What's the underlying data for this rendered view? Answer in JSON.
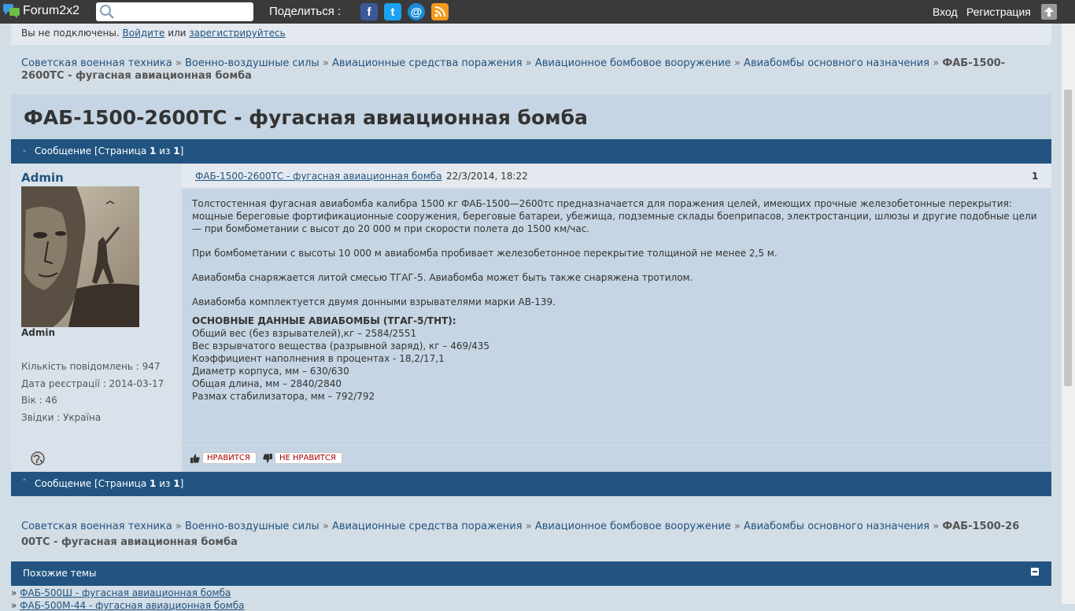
{
  "topbar": {
    "logo_text": "Forum2x2",
    "search_value": "",
    "share_label": "Поделиться :",
    "share_icons": [
      "facebook-icon",
      "twitter-icon",
      "email-icon",
      "rss-icon"
    ],
    "login": "Вход",
    "register": "Регистрация"
  },
  "notice": {
    "prefix": "Вы не подключены.",
    "login_link": "Войдите",
    "or": "или",
    "register_link": "зарегистрируйтесь"
  },
  "breadcrumb": {
    "items": [
      "Советская военная техника",
      "Военно-воздушные силы",
      "Авиационные средства поражения",
      "Авиационное бомбовое вооружение",
      "Авиабомбы основного назначения"
    ],
    "separator": "»",
    "current": "ФАБ-1500-2600ТС - фугасная авиационная бомба"
  },
  "page_title": "ФАБ-1500-2600ТС - фугасная авиационная бомба",
  "pager": {
    "label": "Сообщение [Страница",
    "page": "1",
    "of": "из",
    "total": "1",
    "close": "]"
  },
  "post": {
    "author": "Admin",
    "rank": "Admin",
    "profile": [
      {
        "label": "Кількість повідомлень",
        "value": "947"
      },
      {
        "label": "Дата реєстрації",
        "value": "2014-03-17"
      },
      {
        "label": "Вік",
        "value": "46"
      },
      {
        "label": "Звідки",
        "value": "Україна"
      }
    ],
    "profile_sep": " : ",
    "title_link": "ФАБ-1500-2600ТС - фугасная авиационная бомба",
    "date": "22/3/2014, 18:22",
    "number": "1",
    "paragraphs": [
      "Толстостенная фугасная авиабомба калибра 1500 кг ФАБ-1500—2600тс предназначается для поражения целей, имеющих прочные железобетонные перекрытия: мощные береговые фортификационные сооружения, береговые батареи, убежища, подземные склады боеприпасов, электростанции, шлюзы и другие подобные цели — при бомбометании с высот до 20 000 м при скорости полета до 1500 км/час.",
      "При бомбометании с высоты 10 000 м авиабомба пробивает железобетонное перекрытие толщиной не менее 2,5 м.",
      "Авиабомба снаряжается литой смесью ТГАГ-5. Авиабомба может быть также снаряжена тротилом.",
      "Авиабомба комплектуется двумя донными взрывателями марки АВ-139."
    ],
    "stats_heading": "ОСНОВНЫЕ ДАННЫЕ АВИАБОМБЫ (ТГАГ-5/ТНТ):",
    "stats": [
      "Общий вес (без взрывателей),кг – 2584/2551",
      "Вес взрывчатого вещества (разрывной заряд), кг – 469/435",
      "Коэффициент наполнения в процентах - 18,2/17,1",
      "Диаметр корпуса, мм – 630/630",
      "Общая длина, мм – 2840/2840",
      "Размах стабилизатора, мм – 792/792"
    ],
    "like_label": "НРАВИТСЯ",
    "dislike_label": "НЕ НРАВИТСЯ"
  },
  "breadcrumb_bottom": {
    "line1_tail": "ФАБ-1500-26",
    "line2": "00ТС - фугасная авиационная бомба"
  },
  "similar": {
    "title": "Похожие темы",
    "bullet": "»",
    "topics": [
      "ФАБ-500Ш - фугасная авиационная бомба",
      "ФАБ-500М-44 - фугасная авиационная бомба"
    ]
  },
  "colors": {
    "accent_dark": "#215480",
    "link": "#215480",
    "vote_red": "#a50000",
    "topbar": "#3a3a3a"
  }
}
